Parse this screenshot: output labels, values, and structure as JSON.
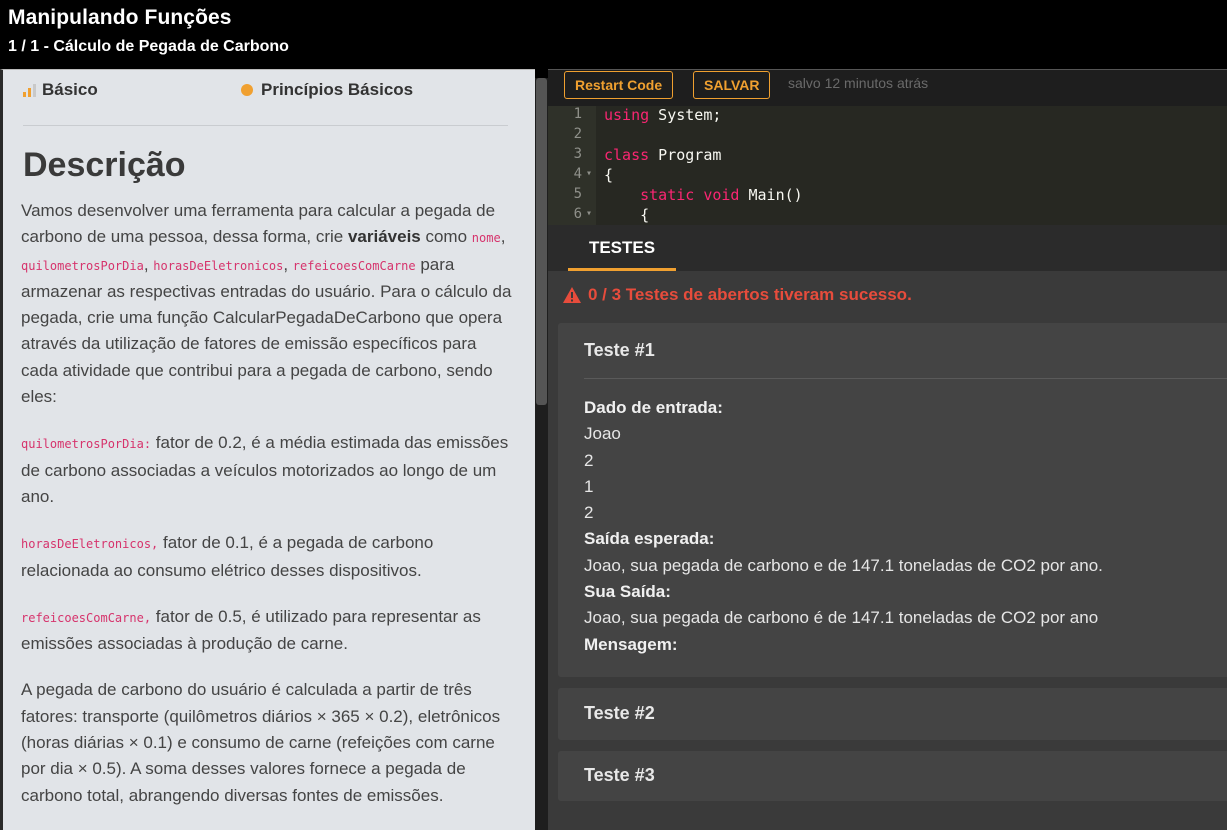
{
  "header": {
    "course_title": "Manipulando Funções",
    "lesson_title": "1 / 1 - Cálculo de Pegada de Carbono"
  },
  "meta": {
    "level": "Básico",
    "category": "Princípios Básicos"
  },
  "description": {
    "title": "Descrição",
    "p1_text1": "Vamos desenvolver uma ferramenta para calcular a pegada de carbono de uma pessoa, dessa forma, crie ",
    "p1_bold": "variáveis",
    "p1_text2": " como ",
    "var_nome": "nome",
    "sep1": ", ",
    "var_km": "quilometrosPorDia",
    "sep2": ", ",
    "var_horas": "horasDeEletronicos",
    "sep3": ",",
    "var_refeicoes": "refeicoesComCarne",
    "p1_text3": " para armazenar as respectivas entradas do usuário. Para o cálculo da pegada, crie uma função CalcularPegadaDeCarbono que opera através da utilização de fatores de emissão específicos para cada atividade que contribui para a pegada de carbono, sendo eles:",
    "p2_code": "quilometrosPorDia:",
    "p2_text": " fator de 0.2, é a média estimada das emissões de carbono associadas a veículos motorizados ao longo de um ano.",
    "p3_code": "horasDeEletronicos,",
    "p3_text": " fator de 0.1, é a pegada de carbono relacionada ao consumo elétrico desses dispositivos.",
    "p4_code": "refeicoesComCarne,",
    "p4_text": " fator de 0.5, é utilizado para representar as emissões associadas à produção de carne.",
    "p5_text": "A pegada de carbono do usuário é calculada a partir de três fatores: transporte (quilômetros diários × 365 × 0.2), eletrônicos (horas diárias × 0.1) e consumo de carne (refeições com carne por dia × 0.5). A soma desses valores fornece a pegada de carbono total, abrangendo diversas fontes de emissões."
  },
  "toolbar": {
    "restart_label": "Restart Code",
    "save_label": "SALVAR",
    "saved_status": "salvo 12 minutos atrás"
  },
  "editor": {
    "lines": [
      {
        "num": "1",
        "kw": "using",
        "rest": " System;"
      },
      {
        "num": "2",
        "kw": "",
        "rest": ""
      },
      {
        "num": "3",
        "kw": "class",
        "rest": " Program"
      },
      {
        "num": "4",
        "kw": "",
        "rest": "{"
      },
      {
        "num": "5",
        "kw": "    static void",
        "rest": " Main()"
      },
      {
        "num": "6",
        "kw": "",
        "rest": "    {"
      }
    ]
  },
  "tests": {
    "tab_label": "TESTES",
    "status": "0 / 3 Testes de abertos tiveram sucesso.",
    "status_color": "#e74c3c",
    "test1": {
      "title": "Teste #1",
      "input_label": "Dado de entrada:",
      "inputs": [
        "Joao",
        "2",
        "1",
        "2"
      ],
      "expected_label": "Saída esperada:",
      "expected": "Joao, sua pegada de carbono e de 147.1 toneladas de CO2 por ano.",
      "output_label": "Sua Saída:",
      "output": "Joao, sua pegada de carbono é de 147.1 toneladas de CO2 por ano",
      "message_label": "Mensagem:"
    },
    "test2": {
      "title": "Teste #2"
    },
    "test3": {
      "title": "Teste #3"
    }
  },
  "colors": {
    "accent": "#f0a030",
    "keyword": "#f92672",
    "inline_code": "#d6336c"
  }
}
